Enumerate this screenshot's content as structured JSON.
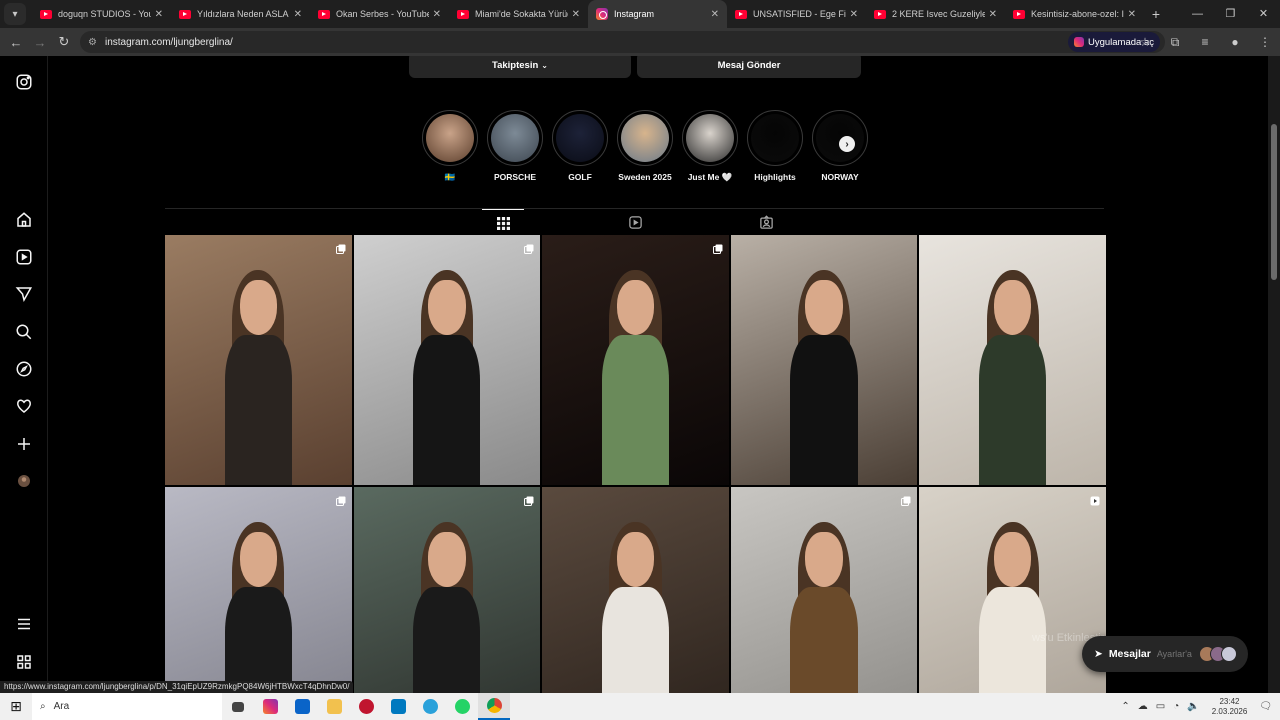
{
  "browser": {
    "tabs": [
      {
        "title": "doguqn STUDIOS - YouTu",
        "icon": "youtube-icon",
        "active": false
      },
      {
        "title": "Yıldızlara Neden ASLA Gi",
        "icon": "youtube-icon",
        "active": false
      },
      {
        "title": "Okan Serbes - YouTube",
        "icon": "youtube-icon",
        "active": false
      },
      {
        "title": "Miami'de Sokakta Yürüdü",
        "icon": "youtube-icon",
        "active": false
      },
      {
        "title": "Instagram",
        "icon": "instagram-icon",
        "active": true
      },
      {
        "title": "UNSATISFIED - Ege Fitnes",
        "icon": "youtube-icon",
        "active": false
      },
      {
        "title": "2 KERE Isvec Guzeliyle Vl",
        "icon": "youtube-icon",
        "active": false
      },
      {
        "title": "Kesintisiz-abone-ozel: Isv",
        "icon": "youtube-icon",
        "active": false
      }
    ],
    "url": "instagram.com/ljungberglina/",
    "open_in_app_label": "Uygulamada aç",
    "status_url": "https://www.instagram.com/ljungberglina/p/DN_31qiEpUZ9RzmkgPQ84W6jHTBWxcT4qDhnDw0/"
  },
  "profile": {
    "following_label": "Takiptesin",
    "message_label": "Mesaj Gönder"
  },
  "highlights": [
    {
      "label": "🇸🇪",
      "colors": [
        "#c9a389",
        "#5b3e2c"
      ]
    },
    {
      "label": "PORSCHE",
      "colors": [
        "#7d8a96",
        "#3d4650"
      ]
    },
    {
      "label": "GOLF",
      "colors": [
        "#1d2238",
        "#0a0c16"
      ]
    },
    {
      "label": "Sweden 2025",
      "colors": [
        "#d7b48c",
        "#6b7a8a"
      ]
    },
    {
      "label": "Just Me 🤍",
      "colors": [
        "#d9d3cc",
        "#2b2b2b"
      ]
    },
    {
      "label": "Highlights",
      "colors": [
        "#050505",
        "#0b0b0b"
      ]
    },
    {
      "label": "NORWAY",
      "colors": [
        "#050505",
        "#0b0b0b"
      ]
    }
  ],
  "posts": [
    {
      "bg": [
        "#9a7c62",
        "#5a4030"
      ],
      "body": "#2a2420",
      "badge": "carousel"
    },
    {
      "bg": [
        "#cfcfcf",
        "#8a8a8a"
      ],
      "body": "#151515",
      "badge": "carousel"
    },
    {
      "bg": [
        "#2a1d18",
        "#0a0606"
      ],
      "body": "#6a8a5a",
      "badge": "carousel"
    },
    {
      "bg": [
        "#b9b0a6",
        "#4b3f35"
      ],
      "body": "#111111",
      "badge": "none"
    },
    {
      "bg": [
        "#e8e4de",
        "#bdb5aa"
      ],
      "body": "#2d3a2a",
      "badge": "none"
    },
    {
      "bg": [
        "#b9b9c4",
        "#7d7d88"
      ],
      "body": "#1a1a1a",
      "badge": "carousel"
    },
    {
      "bg": [
        "#5a6a60",
        "#2a2e2a"
      ],
      "body": "#1a1a1a",
      "badge": "carousel"
    },
    {
      "bg": [
        "#5a4a3e",
        "#2a211b"
      ],
      "body": "#e8e4de",
      "badge": "none"
    },
    {
      "bg": [
        "#c8c6c2",
        "#8c8a86"
      ],
      "body": "#6a4a2a",
      "badge": "carousel"
    },
    {
      "bg": [
        "#d8d2c8",
        "#a89f94"
      ],
      "body": "#ece6dc",
      "badge": "reel"
    }
  ],
  "messages": {
    "label": "Mesajlar",
    "overlay_text": "ws'u Etkinleştir",
    "overlay_sub": "Ayarlar'a",
    "avatar_colors": [
      "#a87a5a",
      "#8a6a8a",
      "#c9c9d9"
    ]
  },
  "taskbar": {
    "search_placeholder": "Ara",
    "time": "23:42",
    "date": "2.03.2026"
  }
}
